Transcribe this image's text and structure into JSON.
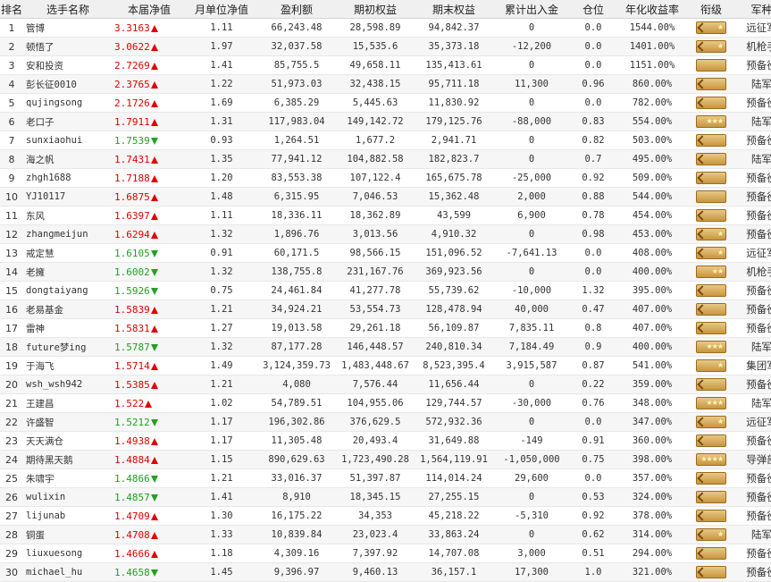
{
  "headers": [
    "排名",
    "选手名称",
    "本届净值",
    "月单位净值",
    "盈利额",
    "期初权益",
    "期末权益",
    "累计出入金",
    "仓位",
    "年化收益率",
    "衔级",
    "军种"
  ],
  "rows": [
    {
      "rank": "1",
      "name": "管博",
      "nav": "3.3163",
      "dir": "up",
      "unit": "1.11",
      "profit": "66,243.48",
      "begin": "28,598.89",
      "end": "94,842.37",
      "flow": "0",
      "pos": "0.0",
      "annual": "1544.00%",
      "stars": "★",
      "chevron": true,
      "arm": "远征军"
    },
    {
      "rank": "2",
      "name": "顿悟了",
      "nav": "3.0622",
      "dir": "up",
      "unit": "1.97",
      "profit": "32,037.58",
      "begin": "15,535.6",
      "end": "35,373.18",
      "flow": "-12,200",
      "pos": "0.0",
      "annual": "1401.00%",
      "stars": "★",
      "chevron": true,
      "arm": "机枪手"
    },
    {
      "rank": "3",
      "name": "安和投资",
      "nav": "2.7269",
      "dir": "up",
      "unit": "1.41",
      "profit": "85,755.5",
      "begin": "49,658.11",
      "end": "135,413.61",
      "flow": "0",
      "pos": "0.0",
      "annual": "1151.00%",
      "stars": "",
      "chevron": false,
      "arm": "预备役"
    },
    {
      "rank": "4",
      "name": "彭长征0010",
      "nav": "2.3765",
      "dir": "up",
      "unit": "1.22",
      "profit": "51,973.03",
      "begin": "32,438.15",
      "end": "95,711.18",
      "flow": "11,300",
      "pos": "0.96",
      "annual": "860.00%",
      "stars": "",
      "chevron": true,
      "arm": "陆军"
    },
    {
      "rank": "5",
      "name": "qujingsong",
      "nav": "2.1726",
      "dir": "up",
      "unit": "1.69",
      "profit": "6,385.29",
      "begin": "5,445.63",
      "end": "11,830.92",
      "flow": "0",
      "pos": "0.0",
      "annual": "782.00%",
      "stars": "",
      "chevron": true,
      "arm": "预备役"
    },
    {
      "rank": "6",
      "name": "老口子",
      "nav": "1.7911",
      "dir": "up",
      "unit": "1.31",
      "profit": "117,983.04",
      "begin": "149,142.72",
      "end": "179,125.76",
      "flow": "-88,000",
      "pos": "0.83",
      "annual": "554.00%",
      "stars": "★★★",
      "chevron": false,
      "arm": "陆军"
    },
    {
      "rank": "7",
      "name": "sunxiaohui",
      "nav": "1.7539",
      "dir": "down",
      "unit": "0.93",
      "profit": "1,264.51",
      "begin": "1,677.2",
      "end": "2,941.71",
      "flow": "0",
      "pos": "0.82",
      "annual": "503.00%",
      "stars": "",
      "chevron": true,
      "arm": "预备役"
    },
    {
      "rank": "8",
      "name": "海之帆",
      "nav": "1.7431",
      "dir": "up",
      "unit": "1.35",
      "profit": "77,941.12",
      "begin": "104,882.58",
      "end": "182,823.7",
      "flow": "0",
      "pos": "0.7",
      "annual": "495.00%",
      "stars": "",
      "chevron": true,
      "arm": "陆军"
    },
    {
      "rank": "9",
      "name": "zhgh1688",
      "nav": "1.7188",
      "dir": "up",
      "unit": "1.20",
      "profit": "83,553.38",
      "begin": "107,122.4",
      "end": "165,675.78",
      "flow": "-25,000",
      "pos": "0.92",
      "annual": "509.00%",
      "stars": "",
      "chevron": true,
      "arm": "预备役"
    },
    {
      "rank": "10",
      "name": "YJ10117",
      "nav": "1.6875",
      "dir": "up",
      "unit": "1.48",
      "profit": "6,315.95",
      "begin": "7,046.53",
      "end": "15,362.48",
      "flow": "2,000",
      "pos": "0.88",
      "annual": "544.00%",
      "stars": "",
      "chevron": false,
      "arm": "预备役"
    },
    {
      "rank": "11",
      "name": "东风",
      "nav": "1.6397",
      "dir": "up",
      "unit": "1.11",
      "profit": "18,336.11",
      "begin": "18,362.89",
      "end": "43,599",
      "flow": "6,900",
      "pos": "0.78",
      "annual": "454.00%",
      "stars": "",
      "chevron": true,
      "arm": "预备役"
    },
    {
      "rank": "12",
      "name": "zhangmeijun",
      "nav": "1.6294",
      "dir": "up",
      "unit": "1.32",
      "profit": "1,896.76",
      "begin": "3,013.56",
      "end": "4,910.32",
      "flow": "0",
      "pos": "0.98",
      "annual": "453.00%",
      "stars": "★",
      "chevron": true,
      "arm": "预备役"
    },
    {
      "rank": "13",
      "name": "戒定慧",
      "nav": "1.6105",
      "dir": "down",
      "unit": "0.91",
      "profit": "60,171.5",
      "begin": "98,566.15",
      "end": "151,096.52",
      "flow": "-7,641.13",
      "pos": "0.0",
      "annual": "408.00%",
      "stars": "★",
      "chevron": true,
      "arm": "远征军"
    },
    {
      "rank": "14",
      "name": "老擁",
      "nav": "1.6002",
      "dir": "down",
      "unit": "1.32",
      "profit": "138,755.8",
      "begin": "231,167.76",
      "end": "369,923.56",
      "flow": "0",
      "pos": "0.0",
      "annual": "400.00%",
      "stars": "★★",
      "chevron": false,
      "arm": "机枪手"
    },
    {
      "rank": "15",
      "name": "dongtaiyang",
      "nav": "1.5926",
      "dir": "down",
      "unit": "0.75",
      "profit": "24,461.84",
      "begin": "41,277.78",
      "end": "55,739.62",
      "flow": "-10,000",
      "pos": "1.32",
      "annual": "395.00%",
      "stars": "",
      "chevron": true,
      "arm": "预备役"
    },
    {
      "rank": "16",
      "name": "老易基金",
      "nav": "1.5839",
      "dir": "up",
      "unit": "1.21",
      "profit": "34,924.21",
      "begin": "53,554.73",
      "end": "128,478.94",
      "flow": "40,000",
      "pos": "0.47",
      "annual": "407.00%",
      "stars": "",
      "chevron": true,
      "arm": "预备役"
    },
    {
      "rank": "17",
      "name": "雷神",
      "nav": "1.5831",
      "dir": "up",
      "unit": "1.27",
      "profit": "19,013.58",
      "begin": "29,261.18",
      "end": "56,109.87",
      "flow": "7,835.11",
      "pos": "0.8",
      "annual": "407.00%",
      "stars": "",
      "chevron": true,
      "arm": "预备役"
    },
    {
      "rank": "18",
      "name": "future梦ing",
      "nav": "1.5787",
      "dir": "down",
      "unit": "1.32",
      "profit": "87,177.28",
      "begin": "146,448.57",
      "end": "240,810.34",
      "flow": "7,184.49",
      "pos": "0.9",
      "annual": "400.00%",
      "stars": "★★★",
      "chevron": false,
      "arm": "陆军"
    },
    {
      "rank": "19",
      "name": "于海飞",
      "nav": "1.5714",
      "dir": "up",
      "unit": "1.49",
      "profit": "3,124,359.73",
      "begin": "1,483,448.67",
      "end": "8,523,395.4",
      "flow": "3,915,587",
      "pos": "0.87",
      "annual": "541.00%",
      "stars": "★",
      "chevron": false,
      "arm": "集团军"
    },
    {
      "rank": "20",
      "name": "wsh_wsh942",
      "nav": "1.5385",
      "dir": "up",
      "unit": "1.21",
      "profit": "4,080",
      "begin": "7,576.44",
      "end": "11,656.44",
      "flow": "0",
      "pos": "0.22",
      "annual": "359.00%",
      "stars": "",
      "chevron": true,
      "arm": "预备役"
    },
    {
      "rank": "21",
      "name": "王建昌",
      "nav": "1.522",
      "dir": "up",
      "unit": "1.02",
      "profit": "54,789.51",
      "begin": "104,955.06",
      "end": "129,744.57",
      "flow": "-30,000",
      "pos": "0.76",
      "annual": "348.00%",
      "stars": "★★★",
      "chevron": false,
      "arm": "陆军"
    },
    {
      "rank": "22",
      "name": "许盛智",
      "nav": "1.5212",
      "dir": "down",
      "unit": "1.17",
      "profit": "196,302.86",
      "begin": "376,629.5",
      "end": "572,932.36",
      "flow": "0",
      "pos": "0.0",
      "annual": "347.00%",
      "stars": "★",
      "chevron": true,
      "arm": "远征军"
    },
    {
      "rank": "23",
      "name": "天天满仓",
      "nav": "1.4938",
      "dir": "up",
      "unit": "1.17",
      "profit": "11,305.48",
      "begin": "20,493.4",
      "end": "31,649.88",
      "flow": "-149",
      "pos": "0.91",
      "annual": "360.00%",
      "stars": "",
      "chevron": true,
      "arm": "预备役"
    },
    {
      "rank": "24",
      "name": "期待黑天鹅",
      "nav": "1.4884",
      "dir": "up",
      "unit": "1.15",
      "profit": "890,629.63",
      "begin": "1,723,490.28",
      "end": "1,564,119.91",
      "flow": "-1,050,000",
      "pos": "0.75",
      "annual": "398.00%",
      "stars": "★★★★",
      "chevron": false,
      "arm": "导弹部"
    },
    {
      "rank": "25",
      "name": "朱啸宇",
      "nav": "1.4866",
      "dir": "down",
      "unit": "1.21",
      "profit": "33,016.37",
      "begin": "51,397.87",
      "end": "114,014.24",
      "flow": "29,600",
      "pos": "0.0",
      "annual": "357.00%",
      "stars": "",
      "chevron": true,
      "arm": "预备役"
    },
    {
      "rank": "26",
      "name": "wulixin",
      "nav": "1.4857",
      "dir": "down",
      "unit": "1.41",
      "profit": "8,910",
      "begin": "18,345.15",
      "end": "27,255.15",
      "flow": "0",
      "pos": "0.53",
      "annual": "324.00%",
      "stars": "",
      "chevron": true,
      "arm": "预备役"
    },
    {
      "rank": "27",
      "name": "lijunab",
      "nav": "1.4709",
      "dir": "up",
      "unit": "1.30",
      "profit": "16,175.22",
      "begin": "34,353",
      "end": "45,218.22",
      "flow": "-5,310",
      "pos": "0.92",
      "annual": "378.00%",
      "stars": "",
      "chevron": true,
      "arm": "预备役"
    },
    {
      "rank": "28",
      "name": "铜蛋",
      "nav": "1.4708",
      "dir": "up",
      "unit": "1.33",
      "profit": "10,839.84",
      "begin": "23,023.4",
      "end": "33,863.24",
      "flow": "0",
      "pos": "0.62",
      "annual": "314.00%",
      "stars": "★",
      "chevron": true,
      "arm": "陆军"
    },
    {
      "rank": "29",
      "name": "liuxuesong",
      "nav": "1.4666",
      "dir": "up",
      "unit": "1.18",
      "profit": "4,309.16",
      "begin": "7,397.92",
      "end": "14,707.08",
      "flow": "3,000",
      "pos": "0.51",
      "annual": "294.00%",
      "stars": "",
      "chevron": true,
      "arm": "预备役"
    },
    {
      "rank": "30",
      "name": "michael_hu",
      "nav": "1.4658",
      "dir": "down",
      "unit": "1.45",
      "profit": "9,396.97",
      "begin": "9,460.13",
      "end": "36,157.1",
      "flow": "17,300",
      "pos": "1.0",
      "annual": "321.00%",
      "stars": "",
      "chevron": true,
      "arm": "预备役"
    }
  ]
}
